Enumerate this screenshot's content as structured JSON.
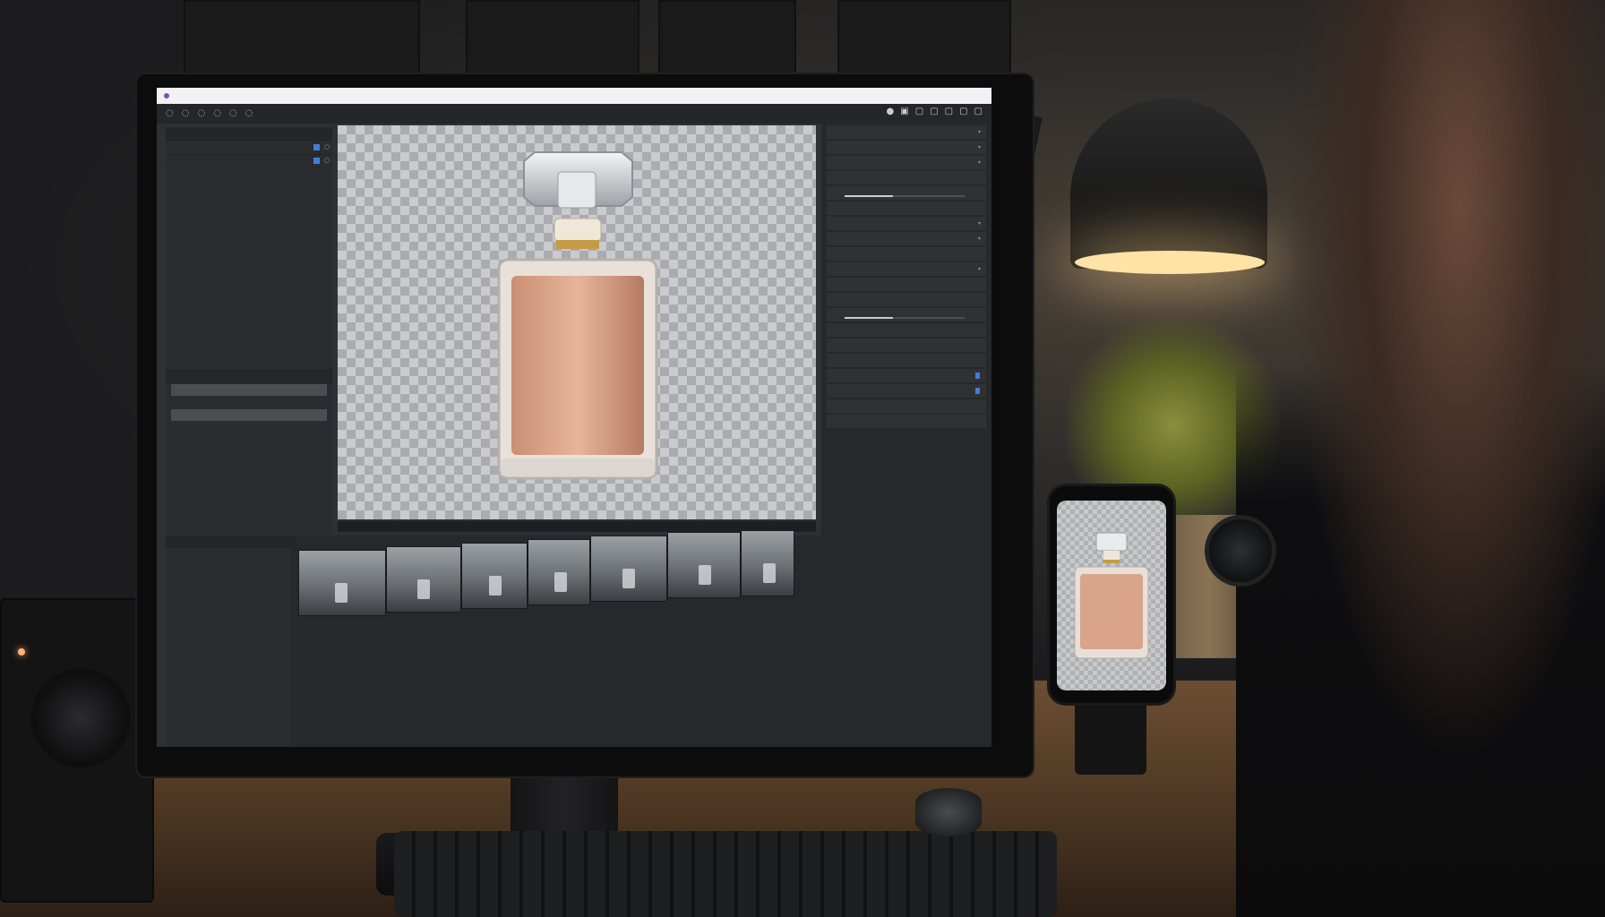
{
  "app": {
    "window_title": "",
    "accent_color": "#3f7fd6"
  },
  "toolbar": {
    "tools": [
      "circle-tool",
      "circle-tool",
      "circle-tool",
      "circle-tool",
      "circle-tool",
      "circle-tool"
    ],
    "right_icons": [
      "view-icon",
      "view-icon",
      "view-icon",
      "view-icon",
      "view-icon",
      "view-icon",
      "view-icon"
    ]
  },
  "left_panel": {
    "tabs": [
      "",
      "",
      ""
    ],
    "layers": [
      "",
      ""
    ],
    "history_title": "",
    "history": [
      "",
      "",
      "",
      ""
    ]
  },
  "right_panel": {
    "rows": [
      "",
      "",
      "",
      "",
      "",
      "",
      "",
      "",
      "",
      "",
      "",
      "",
      "",
      "",
      "",
      "",
      "",
      "",
      "",
      ""
    ]
  },
  "bottom_panel": {
    "title": "",
    "filmstrip_title": "",
    "items": [
      "",
      "",
      "",
      "",
      "",
      "",
      ""
    ]
  }
}
